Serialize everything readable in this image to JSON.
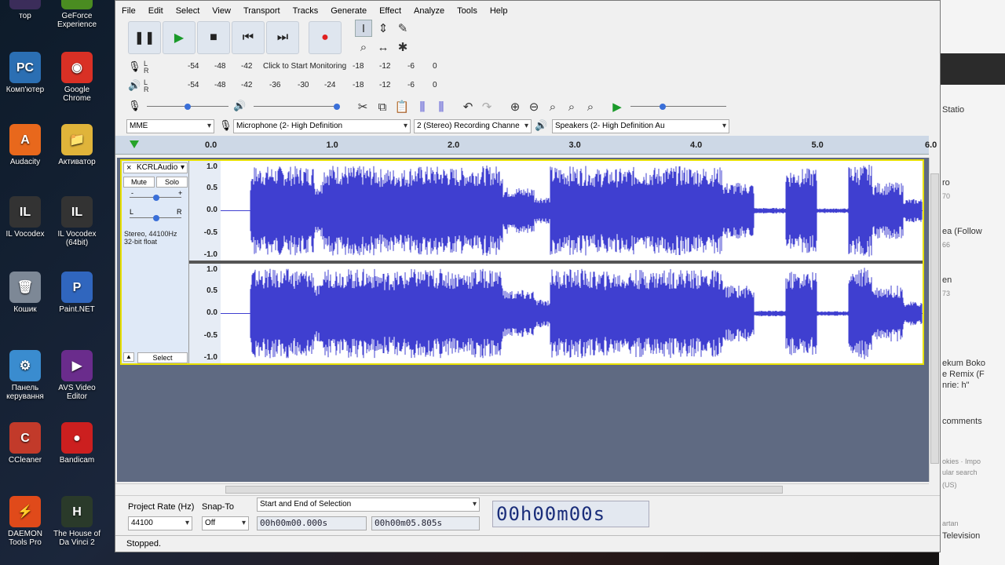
{
  "desktop_icons": [
    {
      "label": "тор",
      "color": "#3b2d5a",
      "glyph": "T"
    },
    {
      "label": "GeForce Experience",
      "color": "#4a8c21",
      "glyph": "G"
    },
    {
      "label": "Комп'ютер",
      "color": "#2b6fb3",
      "glyph": "PC"
    },
    {
      "label": "Google Chrome",
      "color": "#d93025",
      "glyph": "◉"
    },
    {
      "label": "Audacity",
      "color": "#e8681c",
      "glyph": "A"
    },
    {
      "label": "Активатор",
      "color": "#e0b43a",
      "glyph": "📁"
    },
    {
      "label": "IL Vocodex",
      "color": "#333333",
      "glyph": "IL"
    },
    {
      "label": "IL Vocodex (64bit)",
      "color": "#333333",
      "glyph": "IL"
    },
    {
      "label": "Кошик",
      "color": "#7d8896",
      "glyph": "🗑"
    },
    {
      "label": "Paint.NET",
      "color": "#3066be",
      "glyph": "P"
    },
    {
      "label": "Панель керування",
      "color": "#3a8ccf",
      "glyph": "⚙"
    },
    {
      "label": "AVS Video Editor",
      "color": "#6a2c8c",
      "glyph": "▶"
    },
    {
      "label": "CCleaner",
      "color": "#c23a2a",
      "glyph": "C"
    },
    {
      "label": "Bandicam",
      "color": "#cc1f1f",
      "glyph": "●"
    },
    {
      "label": "DAEMON Tools Pro",
      "color": "#e04a1a",
      "glyph": "⚡"
    },
    {
      "label": "The House of Da Vinci 2",
      "color": "#2a3a2a",
      "glyph": "H"
    }
  ],
  "bg_window": {
    "fragments": [
      "Statio",
      "ro",
      "70",
      "ea (Follow",
      "66",
      "en",
      "73",
      "ekum Boko",
      "e Remix (F",
      "nrie: h\"",
      "comments",
      "okies · Impo",
      "ular search",
      "(US)",
      "artan",
      "Television"
    ]
  },
  "menu": [
    "File",
    "Edit",
    "Select",
    "View",
    "Transport",
    "Tracks",
    "Generate",
    "Effect",
    "Analyze",
    "Tools",
    "Help"
  ],
  "meters": {
    "record_scale": [
      "-54",
      "-48",
      "-42",
      "-18",
      "-12",
      "-6",
      "0"
    ],
    "record_monitor": "Click to Start Monitoring",
    "play_scale": [
      "-54",
      "-48",
      "-42",
      "-36",
      "-30",
      "-24",
      "-18",
      "-12",
      "-6",
      "0"
    ],
    "l": "L",
    "r": "R"
  },
  "device": {
    "host": "MME",
    "mic": "Microphone (2- High Definition",
    "channels": "2 (Stereo) Recording Channe",
    "speakers": "Speakers (2- High Definition Au"
  },
  "timeline_ticks": [
    "0.0",
    "1.0",
    "2.0",
    "3.0",
    "4.0",
    "5.0",
    "6.0"
  ],
  "track": {
    "name": "KCRLAudio",
    "mute": "Mute",
    "solo": "Solo",
    "gain_minus": "-",
    "gain_plus": "+",
    "pan_l": "L",
    "pan_r": "R",
    "info1": "Stereo, 44100Hz",
    "info2": "32-bit float",
    "select": "Select",
    "scale": [
      "1.0",
      "0.5",
      "0.0",
      "-0.5",
      "-1.0"
    ]
  },
  "selection": {
    "rate_label": "Project Rate (Hz)",
    "rate_value": "44100",
    "snap_label": "Snap-To",
    "snap_value": "Off",
    "mode": "Start and End of Selection",
    "start": "00h00m00.000s",
    "end": "00h00m05.805s",
    "audio_pos": "00h00m00s"
  },
  "status": "Stopped.",
  "colors": {
    "wave": "#3f3fd0",
    "track_border": "#e8e000",
    "timeline": "#cdd8e6"
  }
}
